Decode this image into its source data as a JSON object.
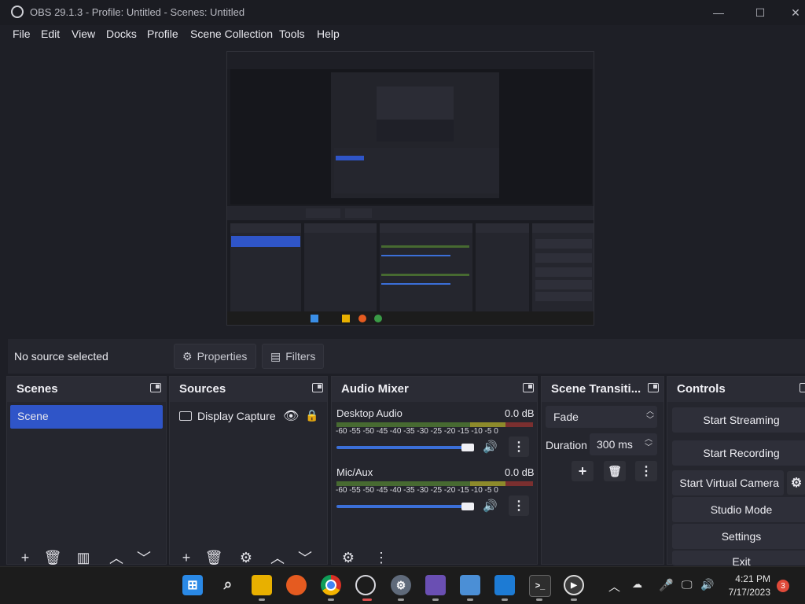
{
  "window": {
    "title": "OBS 29.1.3 - Profile: Untitled - Scenes: Untitled",
    "minimize": "—",
    "maximize": "☐",
    "close": "✕"
  },
  "menu": [
    "File",
    "Edit",
    "View",
    "Docks",
    "Profile",
    "Scene Collection",
    "Tools",
    "Help"
  ],
  "source_bar": {
    "status": "No source selected",
    "properties_label": "Properties",
    "filters_label": "Filters"
  },
  "scenes": {
    "title": "Scenes",
    "items": [
      "Scene"
    ]
  },
  "sources": {
    "title": "Sources",
    "items": [
      {
        "name": "Display Capture",
        "visible": true,
        "locked": false
      }
    ]
  },
  "audio_mixer": {
    "title": "Audio Mixer",
    "scale": "-60 -55 -50 -45 -40 -35 -30 -25 -20 -15 -10 -5 0",
    "channels": [
      {
        "name": "Desktop Audio",
        "level": "0.0 dB",
        "volume_fraction": 0.96
      },
      {
        "name": "Mic/Aux",
        "level": "0.0 dB",
        "volume_fraction": 0.96
      }
    ]
  },
  "transitions": {
    "title": "Scene Transiti...",
    "selected": "Fade",
    "duration_label": "Duration",
    "duration_value": "300 ms"
  },
  "controls": {
    "title": "Controls",
    "buttons": [
      "Start Streaming",
      "Start Recording",
      "Start Virtual Camera",
      "Studio Mode",
      "Settings",
      "Exit"
    ]
  },
  "taskbar": {
    "time": "4:21 PM",
    "date": "7/17/2023",
    "notification_count": "3",
    "apps": [
      "start-icon",
      "search-icon",
      "file-explorer-icon",
      "firefox-icon",
      "chrome-icon",
      "obs-icon",
      "settings-icon",
      "video-editor-icon",
      "image-viewer-icon",
      "media-icon",
      "terminal-icon",
      "player-icon"
    ]
  },
  "colors": {
    "accent": "#2f55c8",
    "panel": "#25262e",
    "background": "#1e1f26",
    "slider": "#3b6fd8"
  }
}
